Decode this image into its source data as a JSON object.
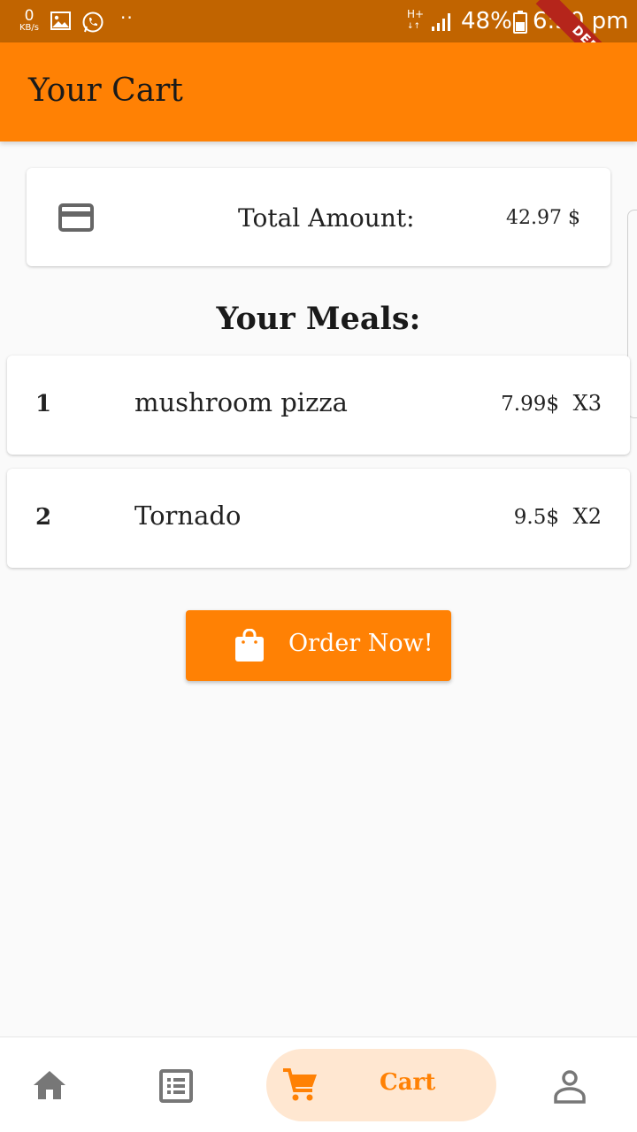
{
  "status_bar": {
    "net_speed": "0",
    "net_speed_unit": "KB/s",
    "dots": "··",
    "network_type": "H+",
    "battery_percent": "48%",
    "time": "6:30 pm",
    "debug_label": "DEBUG"
  },
  "app_bar": {
    "title": "Your Cart"
  },
  "summary": {
    "total_label": "Total Amount:",
    "total_value": "42.97 $",
    "icon": "credit-card-icon"
  },
  "meals_title": "Your Meals:",
  "meals": [
    {
      "index": "1",
      "name": "mushroom pizza",
      "price": "7.99$",
      "quantity": "X3"
    },
    {
      "index": "2",
      "name": "Tornado",
      "price": "9.5$",
      "quantity": "X2"
    }
  ],
  "order_button": {
    "label": "Order Now!",
    "icon": "shopping-bag-icon"
  },
  "bottom_nav": {
    "items": [
      {
        "icon": "home-icon"
      },
      {
        "icon": "list-icon"
      },
      {
        "icon": "cart-icon",
        "label": "Cart",
        "active": true
      },
      {
        "icon": "person-icon"
      }
    ]
  },
  "colors": {
    "primary": "#ff8104",
    "status_bar": "#c16400",
    "active_nav_bg": "#ffe7d1",
    "debug_ribbon": "#b5251b"
  }
}
